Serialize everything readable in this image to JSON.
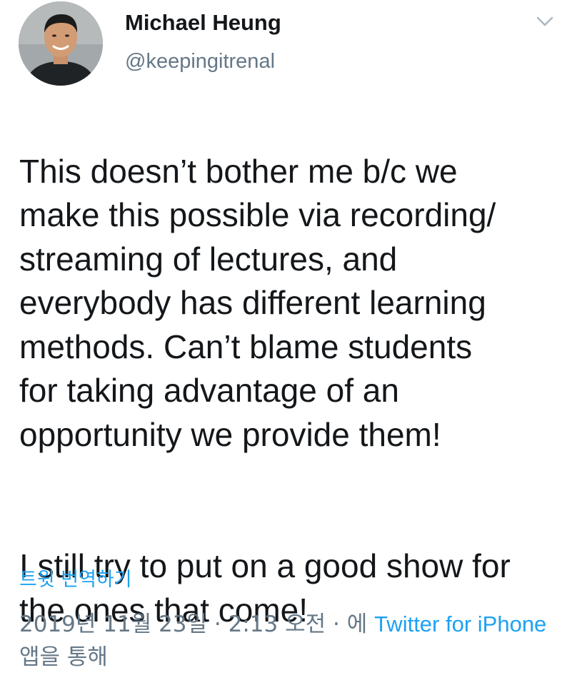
{
  "author": {
    "display_name": "Michael Heung",
    "handle": "@keepingitrenal"
  },
  "tweet": {
    "paragraph_1": "This doesn’t bother me b/c we\nmake this possible via recording/\nstreaming of lectures, and\neverybody has different learning\nmethods. Can’t blame students\nfor taking advantage of an\nopportunity we provide them!",
    "paragraph_2": "I still try to put on a good show for\nthe ones that come!"
  },
  "translate_label": "트윗 번역하기",
  "meta": {
    "date": "2019년 11월 23일",
    "separator": " · ",
    "time": "2:13 오전",
    "via_prefix": "에 ",
    "source": "Twitter for iPhone",
    "via_suffix": "앱을 통해"
  },
  "icons": {
    "menu": "chevron-down-icon",
    "avatar": "profile-photo"
  },
  "colors": {
    "link": "#1da1f2",
    "secondary_text": "#657786",
    "primary_text": "#14171a"
  }
}
